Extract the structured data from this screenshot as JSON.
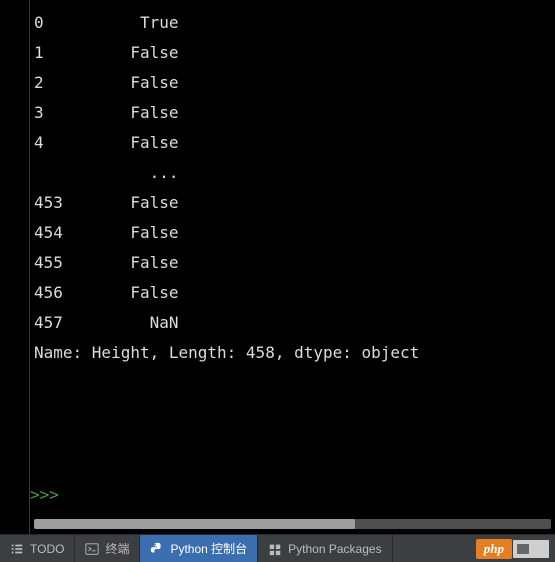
{
  "output": {
    "rows": [
      {
        "index": "0",
        "value": "True"
      },
      {
        "index": "1",
        "value": "False"
      },
      {
        "index": "2",
        "value": "False"
      },
      {
        "index": "3",
        "value": "False"
      },
      {
        "index": "4",
        "value": "False"
      },
      {
        "index": "",
        "value": "..."
      },
      {
        "index": "453",
        "value": "False"
      },
      {
        "index": "454",
        "value": "False"
      },
      {
        "index": "455",
        "value": "False"
      },
      {
        "index": "456",
        "value": "False"
      },
      {
        "index": "457",
        "value": "NaN"
      }
    ],
    "footer": "Name: Height, Length: 458, dtype: object",
    "series_name": "Height",
    "series_length": 458,
    "series_dtype": "object"
  },
  "prompt": ">>>",
  "toolbar": {
    "todo": "TODO",
    "terminal": "终端",
    "console": "Python 控制台",
    "packages": "Python Packages"
  },
  "brand": {
    "label": "php"
  },
  "colors": {
    "background": "#000000",
    "text": "#dcdcdc",
    "prompt": "#4a9a4a",
    "toolbar_bg": "#3c3f41",
    "active_tab": "#3b6eaf",
    "brand_bg": "#e67e22"
  }
}
